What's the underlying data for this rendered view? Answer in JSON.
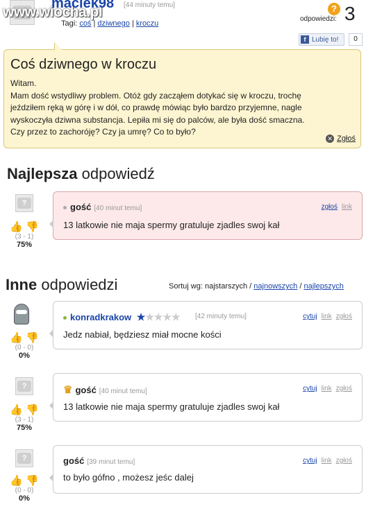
{
  "watermark": "www.wiocha.pl",
  "question": {
    "author": "maciek98",
    "time": "[44 minuty temu]",
    "tags_label": "Tagi:",
    "tags": [
      "coś",
      "dziwnego",
      "kroczu"
    ],
    "title": "Coś dziwnego w kroczu",
    "body": [
      "Witam.",
      "Mam dość wstydliwy problem. Otóż gdy zacząłem dotykać się w kroczu, trochę",
      "jeździłem ręką w górę i w dół, co prawdę mówiąc było bardzo przyjemne, nagle",
      "wyskoczyła dziwna substancja. Lepiła mi się do palców, ale była dość smaczna.",
      "Czy przez to zachoróję? Czy ja umrę? Co to było?"
    ],
    "report": "Zgłoś",
    "answers_label": "odpowiedzi:",
    "answers_count": "3",
    "like_label": "Lubię to!",
    "like_count": "0"
  },
  "best": {
    "heading_bold": "Najlepsza",
    "heading_rest": " odpowiedź",
    "answer": {
      "name": "gość",
      "time": "[40 minut temu]",
      "actions": [
        "zgłoś",
        "link"
      ],
      "text": "13 latkowie nie maja spermy gratuluje zjadles swoj kał",
      "votes": "(3 - 1)",
      "pct": "75%"
    }
  },
  "others": {
    "heading_bold": "Inne",
    "heading_rest": " odpowiedzi",
    "sort_label": "Sortuj wg:",
    "sort_current": "najstarszych",
    "sort_options": [
      "najnowszych",
      "najlepszych"
    ],
    "answers": [
      {
        "name": "konradkrakow",
        "time": "[42 minuty temu]",
        "actions": [
          "cytuj",
          "link",
          "zgłoś"
        ],
        "text": "Jedz nabiał, będziesz miał mocne kości",
        "votes": "(0 - 0)",
        "pct": "0%",
        "stars": 1
      },
      {
        "name": "gość",
        "time": "[40 minut temu]",
        "actions": [
          "cytuj",
          "link",
          "zgłoś"
        ],
        "text": "13 latkowie nie maja spermy gratuluje zjadles swoj kał",
        "votes": "(3 - 1)",
        "pct": "75%"
      },
      {
        "name": "gość",
        "time": "[39 minut temu]",
        "actions": [
          "cytuj",
          "link",
          "zgłoś"
        ],
        "text": "to było gófno , możesz jeśc dalej",
        "votes": "(0 - 0)",
        "pct": "0%"
      }
    ]
  },
  "avatar_text": "?"
}
